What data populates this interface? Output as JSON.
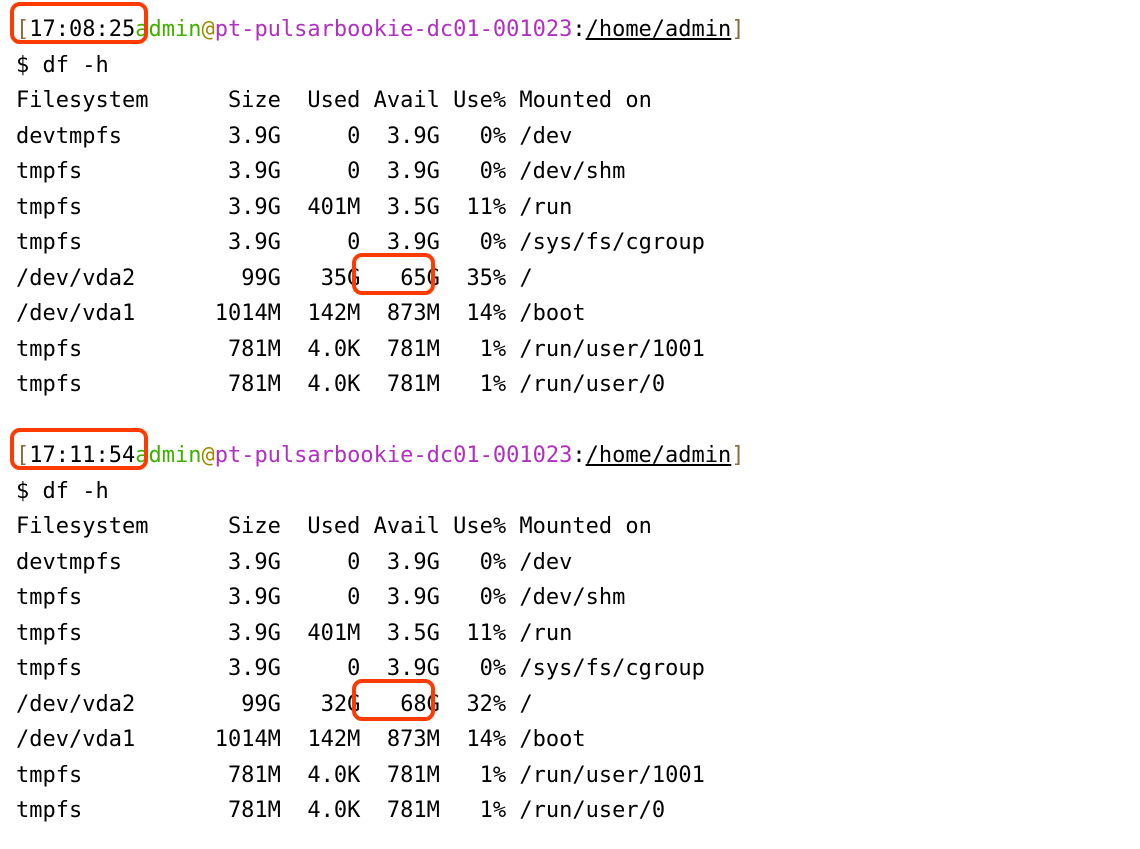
{
  "blocks": [
    {
      "prompt": {
        "time": "17:08:25",
        "user": "admin",
        "host": "pt-pulsarbookie-dc01-001023",
        "path": "/home/admin"
      },
      "command": "$ df -h",
      "header": {
        "fs": "Filesystem",
        "size": "Size",
        "used": "Used",
        "avail": "Avail",
        "usep": "Use%",
        "mount": "Mounted on"
      },
      "rows": [
        {
          "fs": "devtmpfs",
          "size": "3.9G",
          "used": "0",
          "avail": "3.9G",
          "usep": "0%",
          "mount": "/dev"
        },
        {
          "fs": "tmpfs",
          "size": "3.9G",
          "used": "0",
          "avail": "3.9G",
          "usep": "0%",
          "mount": "/dev/shm"
        },
        {
          "fs": "tmpfs",
          "size": "3.9G",
          "used": "401M",
          "avail": "3.5G",
          "usep": "11%",
          "mount": "/run"
        },
        {
          "fs": "tmpfs",
          "size": "3.9G",
          "used": "0",
          "avail": "3.9G",
          "usep": "0%",
          "mount": "/sys/fs/cgroup"
        },
        {
          "fs": "/dev/vda2",
          "size": "99G",
          "used": "35G",
          "avail": "65G",
          "usep": "35%",
          "mount": "/"
        },
        {
          "fs": "/dev/vda1",
          "size": "1014M",
          "used": "142M",
          "avail": "873M",
          "usep": "14%",
          "mount": "/boot"
        },
        {
          "fs": "tmpfs",
          "size": "781M",
          "used": "4.0K",
          "avail": "781M",
          "usep": "1%",
          "mount": "/run/user/1001"
        },
        {
          "fs": "tmpfs",
          "size": "781M",
          "used": "4.0K",
          "avail": "781M",
          "usep": "1%",
          "mount": "/run/user/0"
        }
      ],
      "highlights": [
        {
          "target": "time"
        },
        {
          "target": "used",
          "row_index": 4
        }
      ]
    },
    {
      "prompt": {
        "time": "17:11:54",
        "user": "admin",
        "host": "pt-pulsarbookie-dc01-001023",
        "path": "/home/admin"
      },
      "command": "$ df -h",
      "header": {
        "fs": "Filesystem",
        "size": "Size",
        "used": "Used",
        "avail": "Avail",
        "usep": "Use%",
        "mount": "Mounted on"
      },
      "rows": [
        {
          "fs": "devtmpfs",
          "size": "3.9G",
          "used": "0",
          "avail": "3.9G",
          "usep": "0%",
          "mount": "/dev"
        },
        {
          "fs": "tmpfs",
          "size": "3.9G",
          "used": "0",
          "avail": "3.9G",
          "usep": "0%",
          "mount": "/dev/shm"
        },
        {
          "fs": "tmpfs",
          "size": "3.9G",
          "used": "401M",
          "avail": "3.5G",
          "usep": "11%",
          "mount": "/run"
        },
        {
          "fs": "tmpfs",
          "size": "3.9G",
          "used": "0",
          "avail": "3.9G",
          "usep": "0%",
          "mount": "/sys/fs/cgroup"
        },
        {
          "fs": "/dev/vda2",
          "size": "99G",
          "used": "32G",
          "avail": "68G",
          "usep": "32%",
          "mount": "/"
        },
        {
          "fs": "/dev/vda1",
          "size": "1014M",
          "used": "142M",
          "avail": "873M",
          "usep": "14%",
          "mount": "/boot"
        },
        {
          "fs": "tmpfs",
          "size": "781M",
          "used": "4.0K",
          "avail": "781M",
          "usep": "1%",
          "mount": "/run/user/1001"
        },
        {
          "fs": "tmpfs",
          "size": "781M",
          "used": "4.0K",
          "avail": "781M",
          "usep": "1%",
          "mount": "/run/user/0"
        }
      ],
      "highlights": [
        {
          "target": "time"
        },
        {
          "target": "used",
          "row_index": 4
        }
      ]
    }
  ],
  "colors": {
    "highlight_border": "#ff3b00",
    "user": "#40b000",
    "host": "#b030c0"
  }
}
